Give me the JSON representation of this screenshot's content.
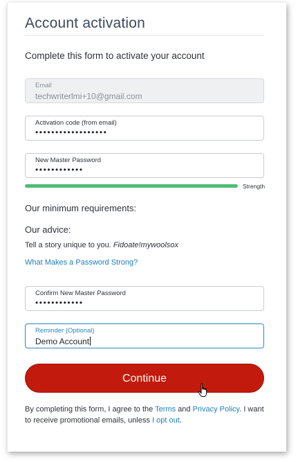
{
  "header": {
    "title": "Account activation",
    "subtitle": "Complete this form to activate your account"
  },
  "form": {
    "email": {
      "label": "Email",
      "value": "techwriterlmi+10@gmail.com"
    },
    "activation_code": {
      "label": "Activation code (from email)",
      "value": "••••••••••••••••••"
    },
    "new_password": {
      "label": "New Master Password",
      "value": "••••••••••••"
    },
    "strength": {
      "label": "Strength",
      "level": 1.0,
      "color": "#4dbd74"
    },
    "requirements_heading": "Our minimum requirements:",
    "advice_heading": "Our advice:",
    "advice_text": "Tell a story unique to you.",
    "advice_example": "Fidoate!mywoolsox",
    "strong_password_link": "What Makes a Password Strong?",
    "confirm_password": {
      "label": "Confirm New Master Password",
      "value": "••••••••••••"
    },
    "reminder": {
      "label": "Reminder (Optional)",
      "value": "Demo Account"
    }
  },
  "actions": {
    "continue_label": "Continue"
  },
  "legal": {
    "text_1": "By completing this form, I agree to the ",
    "terms_link": "Terms",
    "text_2": " and ",
    "privacy_link": "Privacy Policy",
    "text_3": ". I want to receive promotional emails, unless ",
    "opt_out_link": "I opt out",
    "text_4": "."
  },
  "colors": {
    "accent_blue": "#1d7fbf",
    "button_red": "#c21a0c",
    "strength_green": "#4dbd74"
  }
}
